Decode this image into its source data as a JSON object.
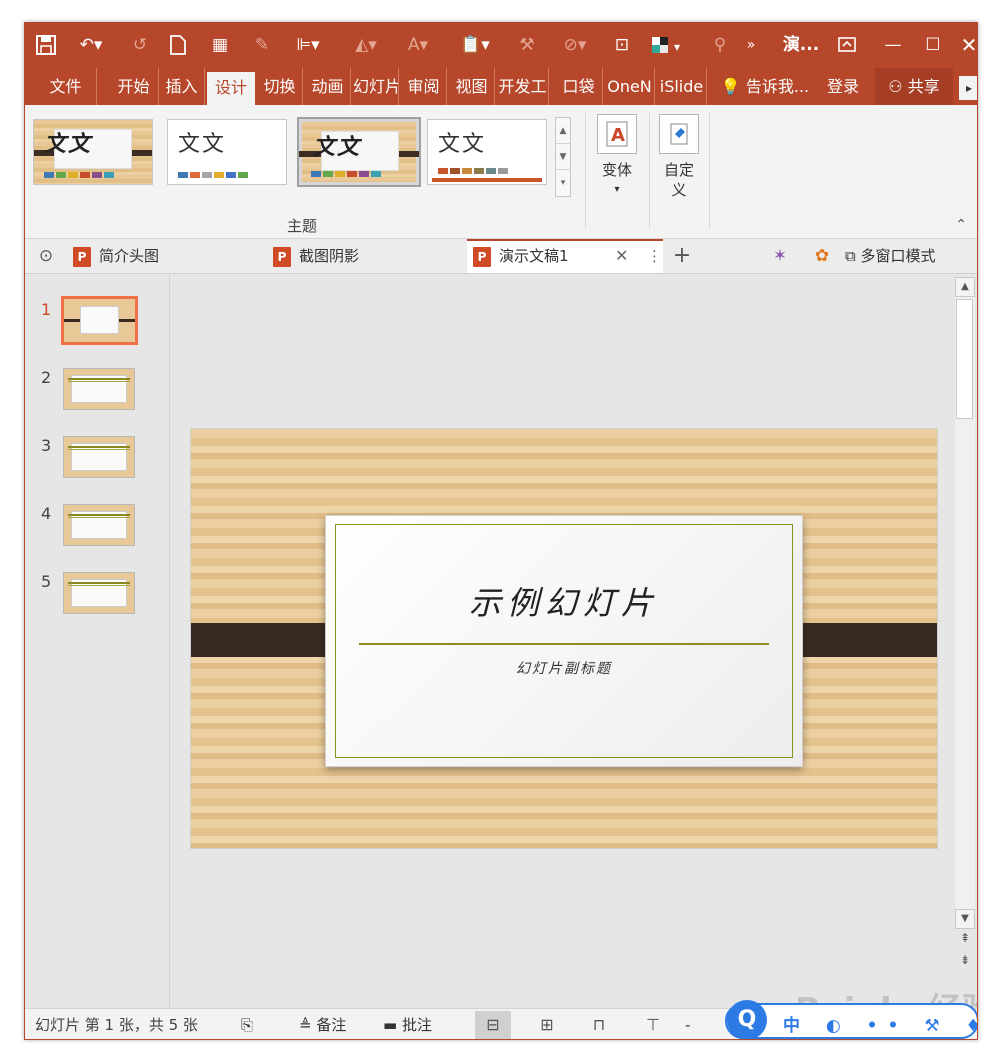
{
  "titlebar": {
    "doc_title": "演...",
    "icons": [
      "save-icon",
      "undo-icon",
      "redo-icon",
      "new-doc-icon",
      "grid-icon",
      "eyedropper-icon",
      "align-icon",
      "fill-icon",
      "font-color-icon",
      "paste-icon",
      "brush-icon",
      "shapes-icon",
      "crop-icon",
      "color-square-icon",
      "layers-icon",
      "more-icon"
    ]
  },
  "tabs": [
    "文件",
    "开始",
    "插入",
    "设计",
    "切换",
    "动画",
    "幻灯片",
    "审阅",
    "视图",
    "开发工",
    "口袋",
    "OneN",
    "iSlide"
  ],
  "active_tab": "设计",
  "tell_me": "告诉我...",
  "login": "登录",
  "share": "共享",
  "ribbon": {
    "themes": [
      {
        "text": "文文",
        "style": "wood"
      },
      {
        "text": "文文",
        "style": "plain"
      },
      {
        "text": "文文",
        "style": "wood-selected"
      },
      {
        "text": "文文",
        "style": "plain-orange"
      }
    ],
    "swatch_colors": [
      "#3e78b5",
      "#63a84a",
      "#e0ae2b",
      "#c74d2e",
      "#8a4e8c",
      "#3aa0b6"
    ],
    "orange_swatch_colors": [
      "#c8562a",
      "#a0522d",
      "#c88a3a",
      "#8a7a4a",
      "#6a8a8a",
      "#9a9a9a"
    ],
    "variants_label": "变体",
    "customize_label": "自定义",
    "group_label": "主题"
  },
  "doc_tabs": [
    {
      "label": "简介头图"
    },
    {
      "label": "截图阴影"
    },
    {
      "label": "演示文稿1",
      "active": true
    }
  ],
  "multi_window": "多窗口模式",
  "slides": [
    {
      "num": "1",
      "selected": true
    },
    {
      "num": "2"
    },
    {
      "num": "3"
    },
    {
      "num": "4"
    },
    {
      "num": "5"
    }
  ],
  "slide": {
    "title": "示例幻灯片",
    "subtitle": "幻灯片副标题"
  },
  "status": {
    "slide_info": "幻灯片 第 1 张，共 5 张",
    "notes": "备注",
    "comments": "批注",
    "zoom_minus": "-"
  },
  "overlay": {
    "watermark": "Bai du 经验",
    "ime_text": "中"
  }
}
